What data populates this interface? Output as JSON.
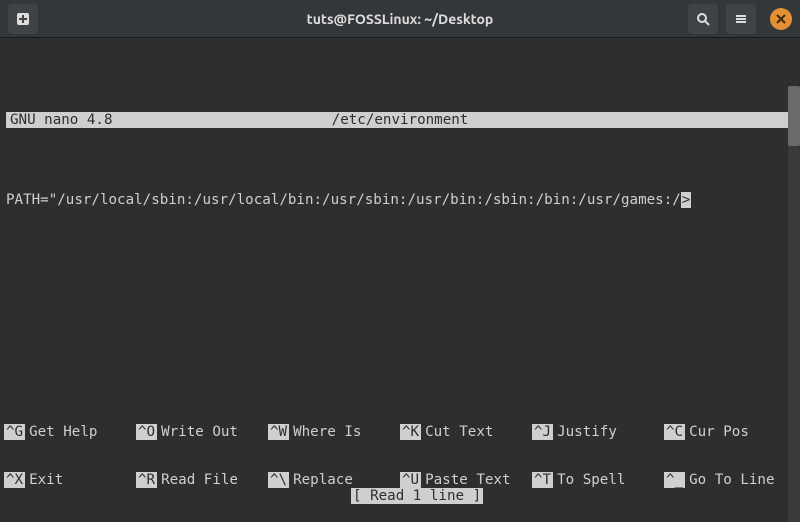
{
  "window": {
    "title": "tuts@FOSSLinux: ~/Desktop"
  },
  "nano": {
    "app_version": "GNU nano 4.8",
    "file_path": "/etc/environment",
    "content_line": "PATH=\"/usr/local/sbin:/usr/local/bin:/usr/sbin:/usr/bin:/sbin:/bin:/usr/games:/",
    "content_cursor": ">",
    "status": "[ Read 1 line ]",
    "shortcuts_row1": [
      {
        "key": "^G",
        "label": "Get Help"
      },
      {
        "key": "^O",
        "label": "Write Out"
      },
      {
        "key": "^W",
        "label": "Where Is"
      },
      {
        "key": "^K",
        "label": "Cut Text"
      },
      {
        "key": "^J",
        "label": "Justify"
      },
      {
        "key": "^C",
        "label": "Cur Pos"
      }
    ],
    "shortcuts_row2": [
      {
        "key": "^X",
        "label": "Exit"
      },
      {
        "key": "^R",
        "label": "Read File"
      },
      {
        "key": "^\\",
        "label": "Replace"
      },
      {
        "key": "^U",
        "label": "Paste Text"
      },
      {
        "key": "^T",
        "label": "To Spell"
      },
      {
        "key": "^_",
        "label": "Go To Line"
      }
    ]
  }
}
